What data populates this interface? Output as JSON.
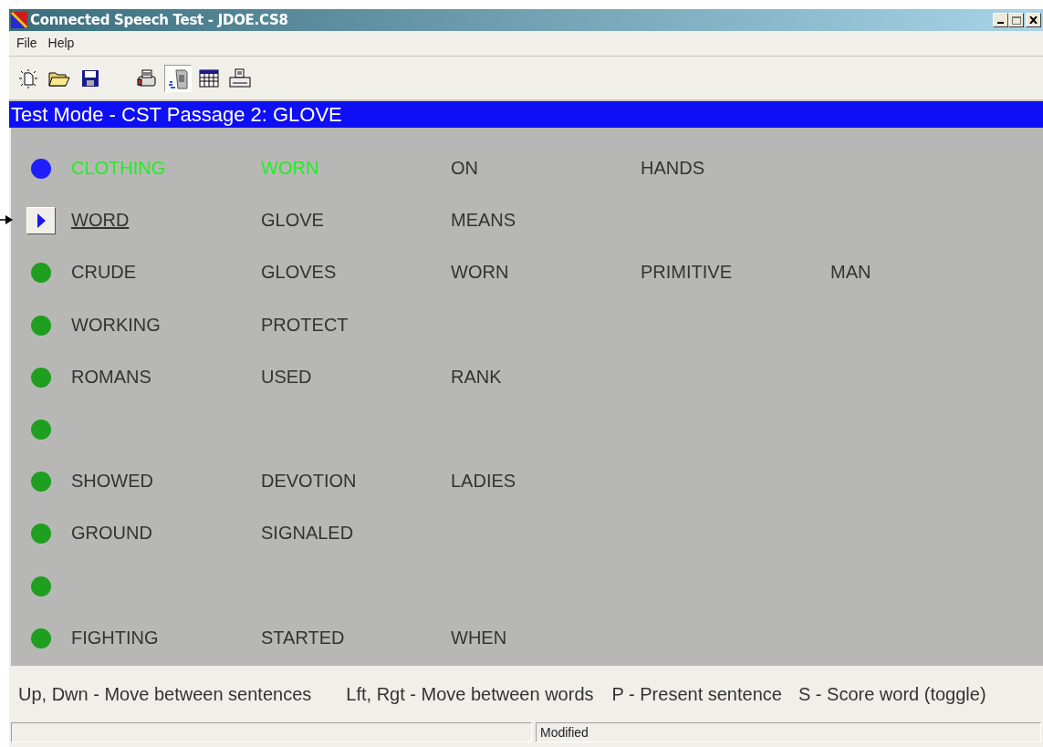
{
  "window": {
    "title": "Connected Speech Test - JDOE.CS8"
  },
  "menu": [
    "File",
    "Help"
  ],
  "toolbar": [
    {
      "pressed": false
    },
    {
      "pressed": false
    },
    {
      "pressed": false
    },
    {
      "pressed": false
    },
    {
      "pressed": true
    },
    {
      "pressed": false
    },
    {
      "pressed": false
    }
  ],
  "mode_banner": "Test Mode - CST Passage 2: GLOVE",
  "sentences": [
    {
      "kind": "dot",
      "color": "#1f1fff",
      "current": false,
      "words": [
        {
          "text": "CLOTHING",
          "scored": true,
          "selected": false
        },
        {
          "text": "WORN",
          "scored": true,
          "selected": false
        },
        {
          "text": "ON",
          "scored": false,
          "selected": false
        },
        {
          "text": "HANDS",
          "scored": false,
          "selected": false
        }
      ]
    },
    {
      "kind": "button",
      "current": true,
      "words": [
        {
          "text": "WORD",
          "scored": false,
          "selected": true
        },
        {
          "text": "GLOVE",
          "scored": false,
          "selected": false
        },
        {
          "text": "MEANS",
          "scored": false,
          "selected": false
        }
      ]
    },
    {
      "kind": "dot",
      "color": "#1f9f1f",
      "current": false,
      "words": [
        {
          "text": "CRUDE",
          "scored": false,
          "selected": false
        },
        {
          "text": "GLOVES",
          "scored": false,
          "selected": false
        },
        {
          "text": "WORN",
          "scored": false,
          "selected": false
        },
        {
          "text": "PRIMITIVE",
          "scored": false,
          "selected": false
        },
        {
          "text": "MAN",
          "scored": false,
          "selected": false
        }
      ]
    },
    {
      "kind": "dot",
      "color": "#1f9f1f",
      "current": false,
      "words": [
        {
          "text": "WORKING",
          "scored": false,
          "selected": false
        },
        {
          "text": "PROTECT",
          "scored": false,
          "selected": false
        }
      ]
    },
    {
      "kind": "dot",
      "color": "#1f9f1f",
      "current": false,
      "words": [
        {
          "text": "ROMANS",
          "scored": false,
          "selected": false
        },
        {
          "text": "USED",
          "scored": false,
          "selected": false
        },
        {
          "text": "RANK",
          "scored": false,
          "selected": false
        }
      ]
    },
    {
      "kind": "dot",
      "color": "#1f9f1f",
      "current": false
    },
    {
      "kind": "dot",
      "color": "#1f9f1f",
      "current": false,
      "words": [
        {
          "text": "SHOWED",
          "scored": false,
          "selected": false
        },
        {
          "text": "DEVOTION",
          "scored": false,
          "selected": false
        },
        {
          "text": "LADIES",
          "scored": false,
          "selected": false
        }
      ]
    },
    {
      "kind": "dot",
      "color": "#1f9f1f",
      "current": false,
      "words": [
        {
          "text": "GROUND",
          "scored": false,
          "selected": false
        },
        {
          "text": "SIGNALED",
          "scored": false,
          "selected": false
        }
      ]
    },
    {
      "kind": "dot",
      "color": "#1f9f1f",
      "current": false
    },
    {
      "kind": "dot",
      "color": "#1f9f1f",
      "current": false,
      "words": [
        {
          "text": "FIGHTING",
          "scored": false,
          "selected": false
        },
        {
          "text": "STARTED",
          "scored": false,
          "selected": false
        },
        {
          "text": "WHEN",
          "scored": false,
          "selected": false
        }
      ]
    }
  ],
  "key_hints": [
    "Up, Dwn - Move between sentences",
    "Lft, Rgt - Move between words",
    "P - Present sentence",
    "S - Score word (toggle)"
  ],
  "status_bar": {
    "state": "Modified"
  }
}
